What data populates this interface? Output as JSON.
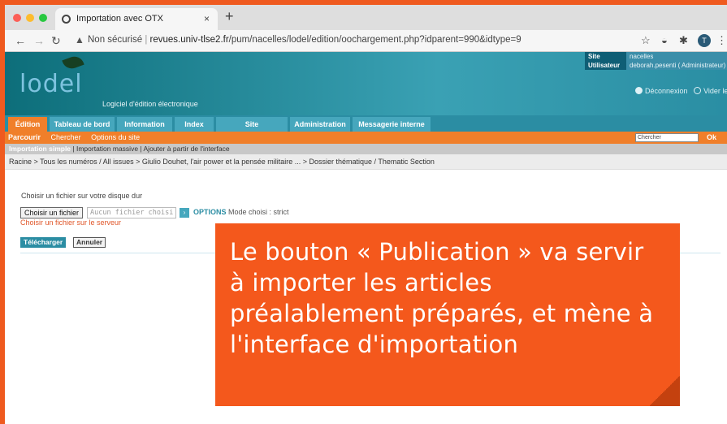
{
  "browser": {
    "tab_title": "Importation avec OTX",
    "tab_close": "×",
    "new_tab": "+",
    "security_label": "Non sécurisé",
    "url_host": "revues.univ-tlse2.fr",
    "url_path": "/pum/nacelles/lodel/edition/oochargement.php?idparent=990&idtype=9",
    "avatar_letter": "T",
    "colors": {
      "chrome": "#dedede",
      "close_dot": "#fc5f57",
      "min_dot": "#fdbc2e",
      "max_dot": "#28c840"
    }
  },
  "lodel": {
    "logo_text": "lodel",
    "tagline": "Logiciel d'édition électronique",
    "info": [
      {
        "key": "Site",
        "value": "nacelles"
      },
      {
        "key": "Utilisateur",
        "value": "deborah.pesenti ( Administrateur)"
      }
    ],
    "logout": "Déconnexion",
    "clear_cache": "Vider le cache",
    "tabs": [
      {
        "label": "Édition",
        "active": true
      },
      {
        "label": "Tableau de bord",
        "active": false
      },
      {
        "label": "Information",
        "active": false
      },
      {
        "label": "Index",
        "active": false
      },
      {
        "label": "Site",
        "active": false
      },
      {
        "label": "Administration",
        "active": false
      },
      {
        "label": "Messagerie interne",
        "active": false
      }
    ],
    "subnav": [
      "Parcourir",
      "Chercher",
      "Options du site"
    ],
    "search_placeholder": "Chercher",
    "search_ok": "Ok",
    "modes": {
      "active": "Importation simple",
      "sep1": " | ",
      "mass": "Importation massive",
      "sep2": " | ",
      "interface": "Ajouter à partir de l'interface"
    },
    "breadcrumb": "Racine  > Tous les numéros / All issues  > Giulio Douhet, l'air power et la pensée militaire ...  > Dossier thématique / Thematic Section",
    "accent_orange": "#f07f2a",
    "accent_teal": "#2b8da3"
  },
  "form": {
    "label_choose": "Choisir un fichier sur votre disque dur",
    "file_button": "Choisir un fichier",
    "no_file": "Aucun fichier choisi",
    "options_button": "›",
    "options_label": "OPTIONS",
    "mode_text": "Mode choisi : strict",
    "server_link": "Choisir un fichier sur le serveur",
    "upload": "Télécharger",
    "cancel": "Annuler"
  },
  "callout": {
    "text": "Le bouton « Publication » va servir à importer les articles préalablement préparés, et mène à l'interface d'importation",
    "background": "#f4581c"
  }
}
